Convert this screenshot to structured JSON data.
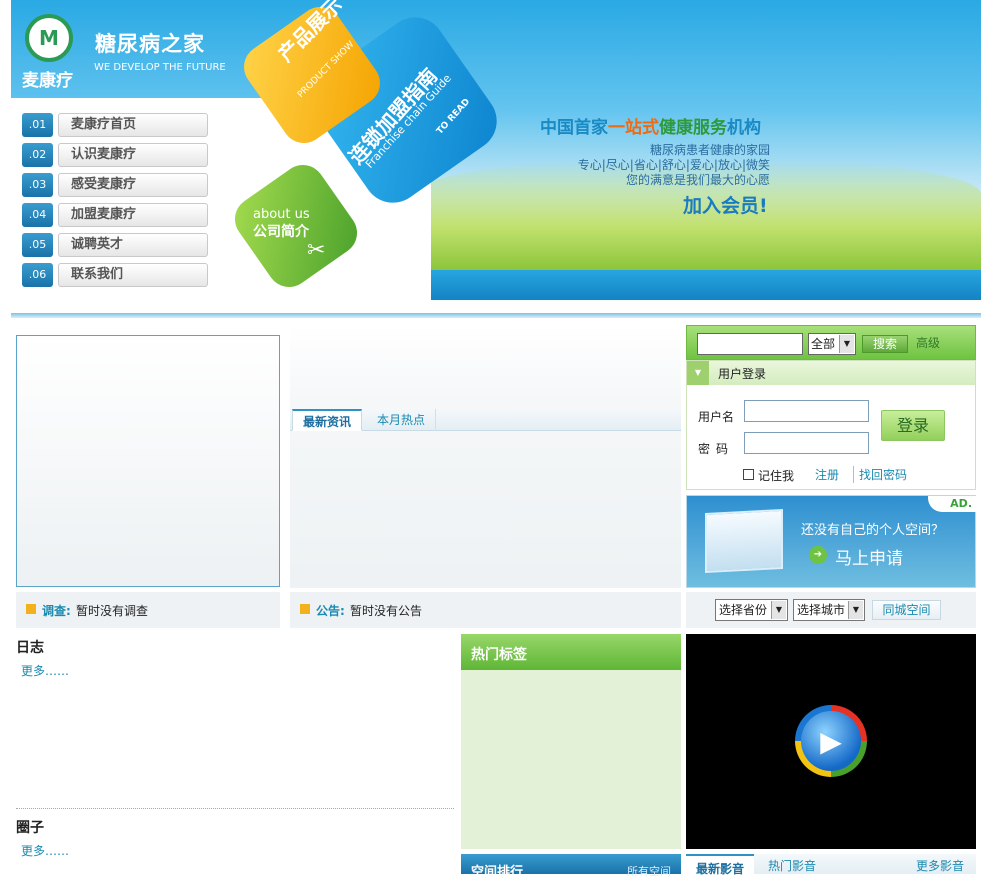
{
  "banner": {
    "logo_glyph": "M",
    "brand_name": "麦康疗",
    "site_title": "糖尿病之家",
    "slogan": "WE DEVELOP THE FUTURE",
    "tiles": {
      "product": "产品展示",
      "product_sub": "PRODUCT SHOW",
      "franchise": "连锁加盟指南",
      "franchise_sub": "Franchise chain Guide",
      "franchise_read": "TO READ",
      "about": "about us",
      "about_cn": "公司简介"
    },
    "headline": {
      "part1": "中国首家",
      "part2": "一站式",
      "part3": "健康服务",
      "part4": "机构"
    },
    "sub_lines": [
      "糖尿病患者健康的家园",
      "专心|尽心|省心|舒心|爱心|放心|微笑",
      "您的满意是我们最大的心愿"
    ],
    "join": "加入会员!"
  },
  "nav": [
    {
      "num": ".01",
      "label": "麦康疗首页"
    },
    {
      "num": ".02",
      "label": "认识麦康疗"
    },
    {
      "num": ".03",
      "label": "感受麦康疗"
    },
    {
      "num": ".04",
      "label": "加盟麦康疗"
    },
    {
      "num": ".05",
      "label": "诚聘英才"
    },
    {
      "num": ".06",
      "label": "联系我们"
    }
  ],
  "news": {
    "tabs": [
      "最新资讯",
      "本月热点"
    ]
  },
  "search": {
    "value": "",
    "scope": "全部",
    "button": "搜索",
    "advanced": "高级"
  },
  "login": {
    "title": "用户登录",
    "username_label": "用户名",
    "password_label": "密码",
    "username_value": "",
    "password_value": "",
    "button": "登录",
    "remember": "记住我",
    "register": "注册",
    "forgot": "找回密码"
  },
  "ad": {
    "tag": "AD.",
    "question": "还没有自己的个人空间？",
    "apply": "马上申请"
  },
  "info": {
    "poll_label": "调查:",
    "poll_text": "暂时没有调查",
    "notice_label": "公告:",
    "notice_text": "暂时没有公告",
    "province": "选择省份",
    "city": "选择城市",
    "same_city": "同城空间"
  },
  "blog": {
    "title": "日志",
    "more": "更多……"
  },
  "circle": {
    "title": "圈子",
    "more": "更多……"
  },
  "tags": {
    "title": "热门标签"
  },
  "rank": {
    "title": "空间排行",
    "all": "所有空间"
  },
  "video": {
    "tabs": [
      "最新影音",
      "热门影音"
    ],
    "more": "更多影音"
  },
  "colors": {
    "accent_blue": "#1a8ab0",
    "green": "#6fc342",
    "orange": "#f5a300"
  }
}
